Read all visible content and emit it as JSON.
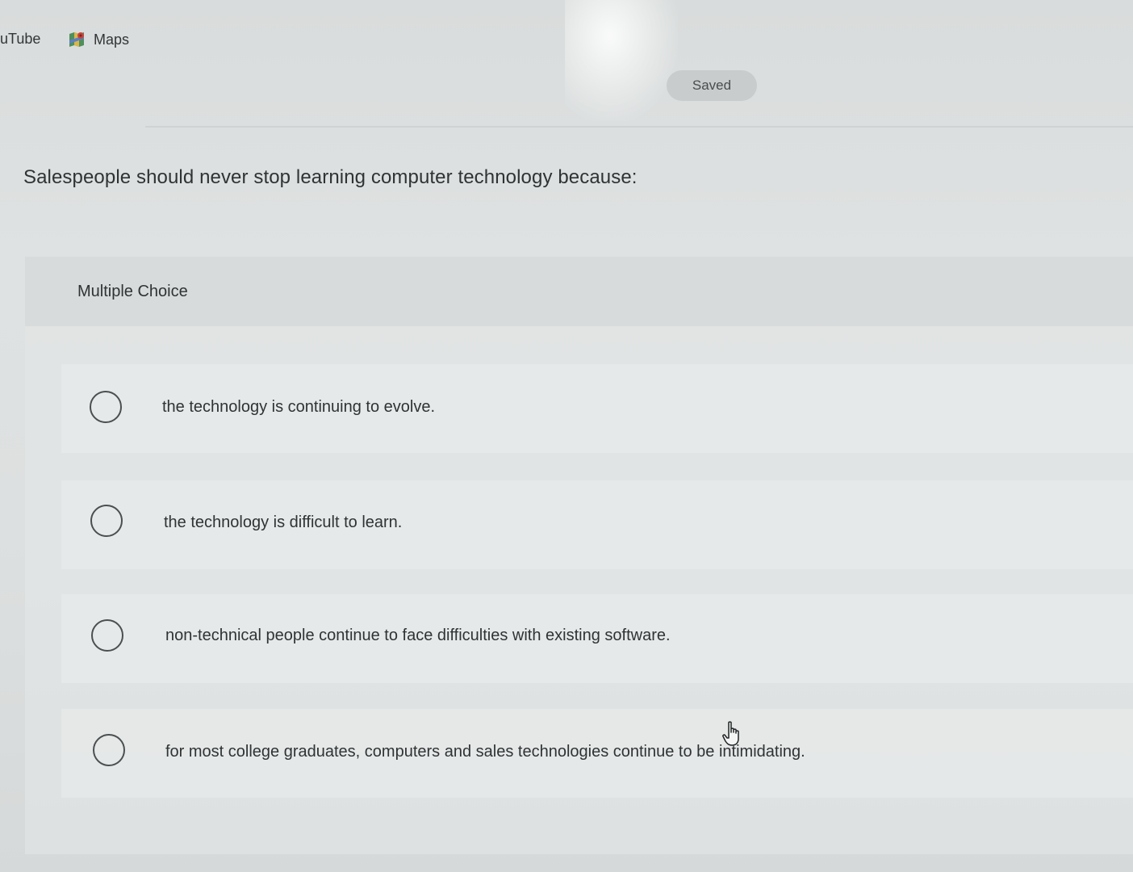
{
  "bookmarks": {
    "youtube_label": "uTube",
    "maps_label": "Maps",
    "maps_icon": "google-maps-icon"
  },
  "status": {
    "saved_label": "Saved"
  },
  "question": {
    "text": "Salespeople should never stop learning computer technology because:",
    "type_label": "Multiple Choice",
    "options": [
      {
        "label": "the technology is continuing to evolve."
      },
      {
        "label": "the technology is difficult to learn."
      },
      {
        "label": "non-technical people continue to face difficulties with existing software."
      },
      {
        "label": "for most college graduates, computers and sales technologies continue to be intimidating."
      }
    ]
  },
  "pointer": {
    "icon": "hand-pointer-icon"
  }
}
